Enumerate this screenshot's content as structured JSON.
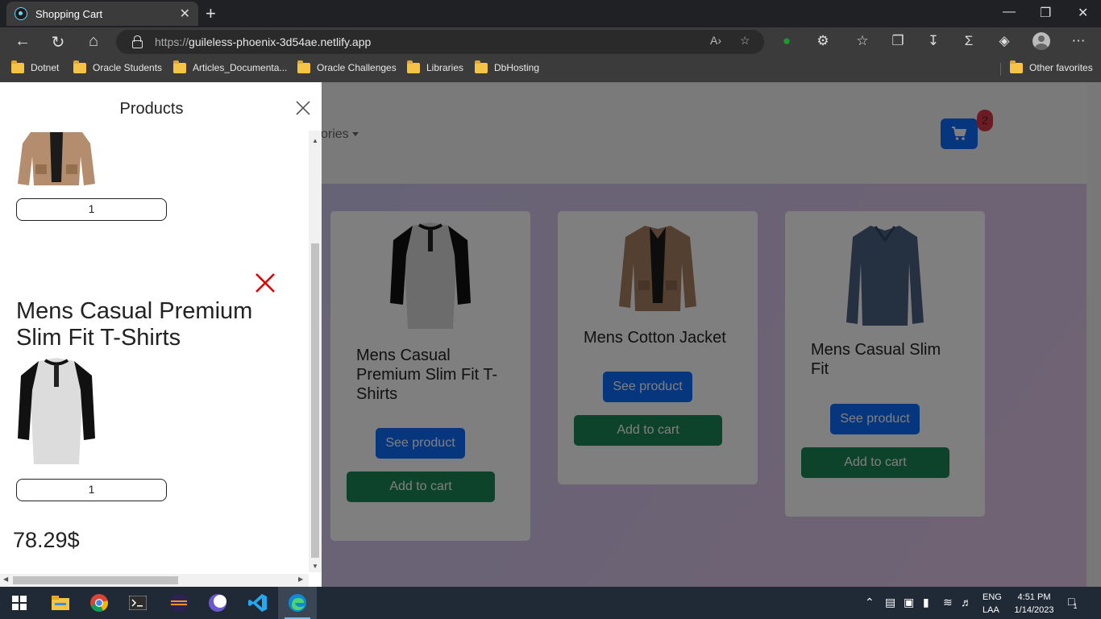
{
  "browser": {
    "tab_title": "Shopping Cart",
    "tab_close": "✕",
    "new_tab": "+",
    "url_scheme": "https://",
    "url_host": "guileless-phoenix-3d54ae.netlify.app",
    "bookmarks": [
      "Dotnet",
      "Oracle Students",
      "Articles_Documenta...",
      "Oracle Challenges",
      "Libraries",
      "DbHosting"
    ],
    "other_favorites": "Other favorites"
  },
  "page": {
    "nav_text": "ories",
    "cart_count": "2",
    "products": [
      {
        "title": "Mens Casual Premium Slim Fit T-Shirts",
        "see_label": "See product",
        "add_label": "Add to cart"
      },
      {
        "title": "Mens Cotton Jacket",
        "see_label": "See product",
        "add_label": "Add to cart"
      },
      {
        "title": "Mens Casual Slim Fit",
        "see_label": "See product",
        "add_label": "Add to cart"
      }
    ]
  },
  "cart_drawer": {
    "title": "Products",
    "items": [
      {
        "title": "",
        "quantity": "1"
      },
      {
        "title": "Mens Casual Premium Slim Fit T-Shirts",
        "quantity": "1"
      }
    ],
    "total": "78.29$"
  },
  "taskbar": {
    "lang_line1": "ENG",
    "lang_line2": "LAA",
    "time": "4:51 PM",
    "date": "1/14/2023",
    "notification_count": "1"
  },
  "colors": {
    "primary": "#0d6efd",
    "success": "#198754",
    "danger": "#dc3545",
    "remove_x": "#e00000"
  }
}
